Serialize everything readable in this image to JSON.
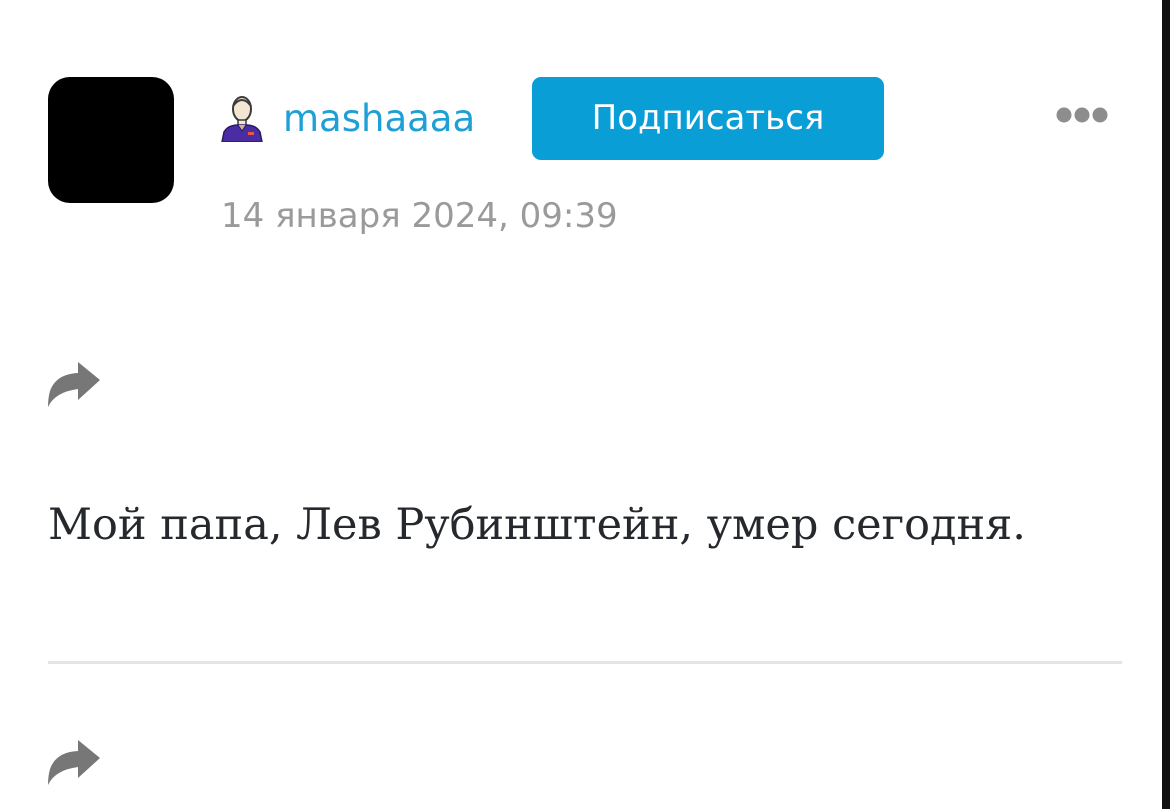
{
  "author": {
    "username": "mashaaaa",
    "avatar_color": "#000000",
    "user_icon": "person-icon",
    "subscribe_label": "Подписаться",
    "subscribe_color": "#0a9ed7",
    "link_color": "#1ea0d7"
  },
  "post": {
    "timestamp": "14 января 2024, 09:39",
    "text": "Мой папа, Лев Рубинштейн, умер сегодня.",
    "text_color": "#25292d"
  },
  "icons": {
    "more": "more-options-icon",
    "share": "share-arrow-icon"
  }
}
